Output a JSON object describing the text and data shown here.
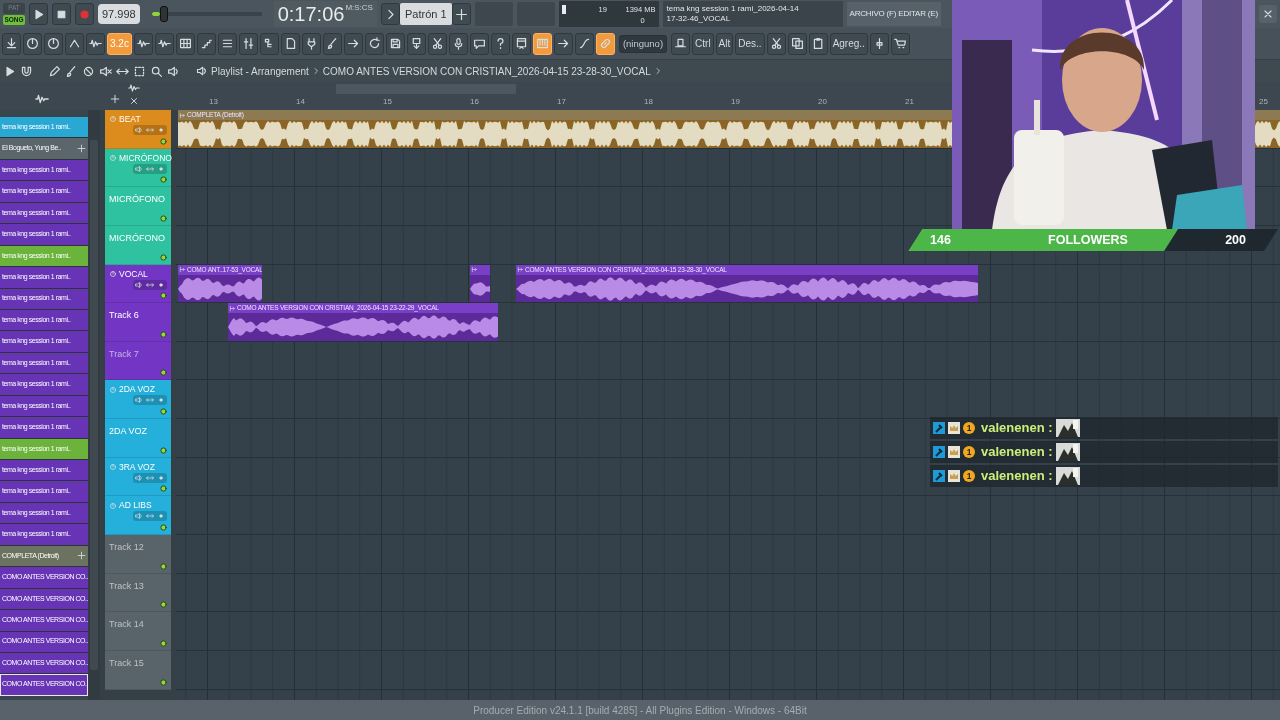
{
  "transport": {
    "modes": [
      {
        "label": "PAT",
        "selected": false
      },
      {
        "label": "SONG",
        "selected": true
      }
    ],
    "tempo": "97.998",
    "pitch": {
      "level": 0.08
    },
    "time": {
      "value": "0:17:06",
      "unit": "M:S:CS"
    },
    "pattern": "Patrón 1"
  },
  "monitor": {
    "voices": "19",
    "memory": "1394 MB",
    "cpu": "0",
    "level": 0.08
  },
  "hint": {
    "line1": "tema kng session 1 rami_2026-04-14",
    "line2": "17-32-46_VOCAL"
  },
  "menu": "ARCHIVO (F) EDITAR (E)",
  "toolbar": [
    {
      "kind": "icon",
      "on": false
    },
    {
      "kind": "icon",
      "on": false
    },
    {
      "kind": "icon",
      "on": false
    },
    {
      "kind": "icon",
      "on": false
    },
    {
      "kind": "icon",
      "on": false
    },
    {
      "kind": "text",
      "label": "3.2c",
      "on": true
    },
    {
      "kind": "icon",
      "on": false
    },
    {
      "kind": "icon",
      "on": false
    },
    {
      "kind": "icon",
      "on": false
    },
    {
      "kind": "icon",
      "on": false
    },
    {
      "kind": "icon",
      "on": false
    },
    {
      "kind": "icon",
      "on": false
    },
    {
      "kind": "icon",
      "on": false
    },
    {
      "kind": "icon",
      "on": false
    },
    {
      "kind": "icon",
      "on": false
    },
    {
      "kind": "icon",
      "on": false
    },
    {
      "kind": "icon",
      "on": false
    },
    {
      "kind": "icon",
      "on": false
    },
    {
      "kind": "icon",
      "on": false
    },
    {
      "kind": "icon",
      "on": false
    },
    {
      "kind": "icon",
      "on": false
    },
    {
      "kind": "icon",
      "on": false
    },
    {
      "kind": "icon",
      "on": false
    },
    {
      "kind": "icon",
      "on": false
    },
    {
      "kind": "icon",
      "on": false
    },
    {
      "kind": "icon",
      "on": true
    },
    {
      "kind": "icon",
      "on": false
    },
    {
      "kind": "icon",
      "on": false
    },
    {
      "kind": "icon",
      "on": true
    },
    {
      "kind": "field",
      "label": "(ninguno)",
      "on": false
    },
    {
      "kind": "icon",
      "on": false
    },
    {
      "kind": "text",
      "label": "Ctrl",
      "on": false
    },
    {
      "kind": "text",
      "label": "Alt",
      "on": false
    },
    {
      "kind": "text",
      "label": "Des..",
      "on": false
    },
    {
      "kind": "icon",
      "on": false
    },
    {
      "kind": "icon",
      "on": false
    },
    {
      "kind": "icon",
      "on": false
    },
    {
      "kind": "text",
      "label": "Agreg..",
      "on": false
    },
    {
      "kind": "icon",
      "on": false
    },
    {
      "kind": "icon",
      "on": false
    }
  ],
  "playlist": {
    "title": "Playlist - Arrangement",
    "path": "COMO ANTES VERSION CON CRISTIAN_2026-04-15 23-28-30_VOCAL",
    "ruler": [
      "13",
      "14",
      "15",
      "16",
      "17",
      "18",
      "19",
      "20",
      "21",
      "25"
    ],
    "picker": [
      {
        "label": "tema kng session 1 rami..",
        "kind": "audio",
        "color": "#2aa8d4",
        "selected": false
      },
      {
        "label": "El Bogueto, Yung Be..",
        "kind": "channel",
        "color": "#5b656c",
        "selected": false
      },
      {
        "label": "tema kng session 1 rami..",
        "kind": "audio",
        "color": "#6634b4",
        "selected": false
      },
      {
        "label": "tema kng session 1 rami..",
        "kind": "audio",
        "color": "#6634b4",
        "selected": false
      },
      {
        "label": "tema kng session 1 rami..",
        "kind": "audio",
        "color": "#6634b4",
        "selected": false
      },
      {
        "label": "tema kng session 1 rami..",
        "kind": "audio",
        "color": "#6634b4",
        "selected": false
      },
      {
        "label": "tema kng session 1 rami..",
        "kind": "audio",
        "color": "#6bb33a",
        "selected": false
      },
      {
        "label": "tema kng session 1 rami..",
        "kind": "audio",
        "color": "#6634b4",
        "selected": false
      },
      {
        "label": "tema kng session 1 rami..",
        "kind": "audio",
        "color": "#6634b4",
        "selected": false
      },
      {
        "label": "tema kng session 1 rami..",
        "kind": "audio",
        "color": "#6634b4",
        "selected": false
      },
      {
        "label": "tema kng session 1 rami..",
        "kind": "audio",
        "color": "#6634b4",
        "selected": false
      },
      {
        "label": "tema kng session 1 rami..",
        "kind": "audio",
        "color": "#6634b4",
        "selected": false
      },
      {
        "label": "tema kng session 1 rami..",
        "kind": "audio",
        "color": "#6634b4",
        "selected": false
      },
      {
        "label": "tema kng session 1 rami..",
        "kind": "audio",
        "color": "#6634b4",
        "selected": false
      },
      {
        "label": "tema kng session 1 rami..",
        "kind": "audio",
        "color": "#6634b4",
        "selected": false
      },
      {
        "label": "tema kng session 1 rami..",
        "kind": "audio",
        "color": "#6bb33a",
        "selected": false
      },
      {
        "label": "tema kng session 1 rami..",
        "kind": "audio",
        "color": "#6634b4",
        "selected": false
      },
      {
        "label": "tema kng session 1 rami..",
        "kind": "audio",
        "color": "#6634b4",
        "selected": false
      },
      {
        "label": "tema kng session 1 rami..",
        "kind": "audio",
        "color": "#6634b4",
        "selected": false
      },
      {
        "label": "tema kng session 1 rami..",
        "kind": "audio",
        "color": "#6634b4",
        "selected": false
      },
      {
        "label": "COMPLETA (Detroit)",
        "kind": "channel",
        "color": "#6b725f",
        "selected": false
      },
      {
        "label": "COMO ANTES VERSION CO..",
        "kind": "audio",
        "color": "#6634b4",
        "selected": false
      },
      {
        "label": "COMO ANTES VERSION CO..",
        "kind": "audio",
        "color": "#6634b4",
        "selected": false
      },
      {
        "label": "COMO ANTES VERSION CO..",
        "kind": "audio",
        "color": "#6634b4",
        "selected": false
      },
      {
        "label": "COMO ANTES VERSION CO..",
        "kind": "audio",
        "color": "#6634b4",
        "selected": false
      },
      {
        "label": "COMO ANTES VERSION CO..",
        "kind": "audio",
        "color": "#6634b4",
        "selected": false
      },
      {
        "label": "COMO ANTES VERSION CO..",
        "kind": "audio",
        "color": "#6634b4",
        "selected": true
      }
    ],
    "tracks": [
      {
        "name": "BEAT",
        "kind": "header",
        "color": "#dc8c1c",
        "clips": [
          {
            "label": "COMPLETA (Detroit)",
            "kind": "beat"
          }
        ]
      },
      {
        "name": "MICRÓFONO",
        "kind": "header",
        "color": "#2ec2a1"
      },
      {
        "name": "MICRÓFONO",
        "kind": "lane",
        "color": "#2ec2a1"
      },
      {
        "name": "MICRÓFONO",
        "kind": "lane",
        "color": "#2ec2a1"
      },
      {
        "name": "VOCAL",
        "kind": "header",
        "color": "#7336c4",
        "clips": [
          {
            "label": "COMO ANT..17-53_VOCAL",
            "kind": "vocal"
          },
          {
            "kind": "vocal"
          },
          {
            "label": "COMO ANTES VERSION CON CRISTIAN_2026-04-15 23-28-30_VOCAL",
            "kind": "vocal"
          }
        ]
      },
      {
        "name": "Track 6",
        "kind": "lane",
        "color": "#7336c4",
        "clips": [
          {
            "label": "COMO ANTES VERSION CON CRISTIAN_2026-04-15 23-22-29_VOCAL",
            "kind": "vocal"
          }
        ]
      },
      {
        "name": "Track 7",
        "kind": "empty",
        "color": "#7336c4"
      },
      {
        "name": "2DA VOZ",
        "kind": "header",
        "color": "#25b0dc"
      },
      {
        "name": "2DA VOZ",
        "kind": "lane",
        "color": "#25b0dc"
      },
      {
        "name": "3RA VOZ",
        "kind": "header",
        "color": "#25b0dc"
      },
      {
        "name": "AD LIBS",
        "kind": "header",
        "color": "#25b0dc"
      },
      {
        "name": "Track 12",
        "kind": "empty",
        "color": "#59636a"
      },
      {
        "name": "Track 13",
        "kind": "empty",
        "color": "#59636a"
      },
      {
        "name": "Track 14",
        "kind": "empty",
        "color": "#59636a"
      },
      {
        "name": "Track 15",
        "kind": "empty",
        "color": "#59636a"
      }
    ]
  },
  "stream": {
    "followers": {
      "current": "146",
      "label": "FOLLOWERS",
      "goal": "200",
      "level": 0.73
    },
    "chat": [
      {
        "user": "valenenen :",
        "badge": "1"
      },
      {
        "user": "valenenen :",
        "badge": "1"
      },
      {
        "user": "valenenen :",
        "badge": "1"
      }
    ]
  },
  "status_bar": "Producer Edition v24.1.1 [build 4285] - All Plugins Edition - Windows - 64Bit"
}
